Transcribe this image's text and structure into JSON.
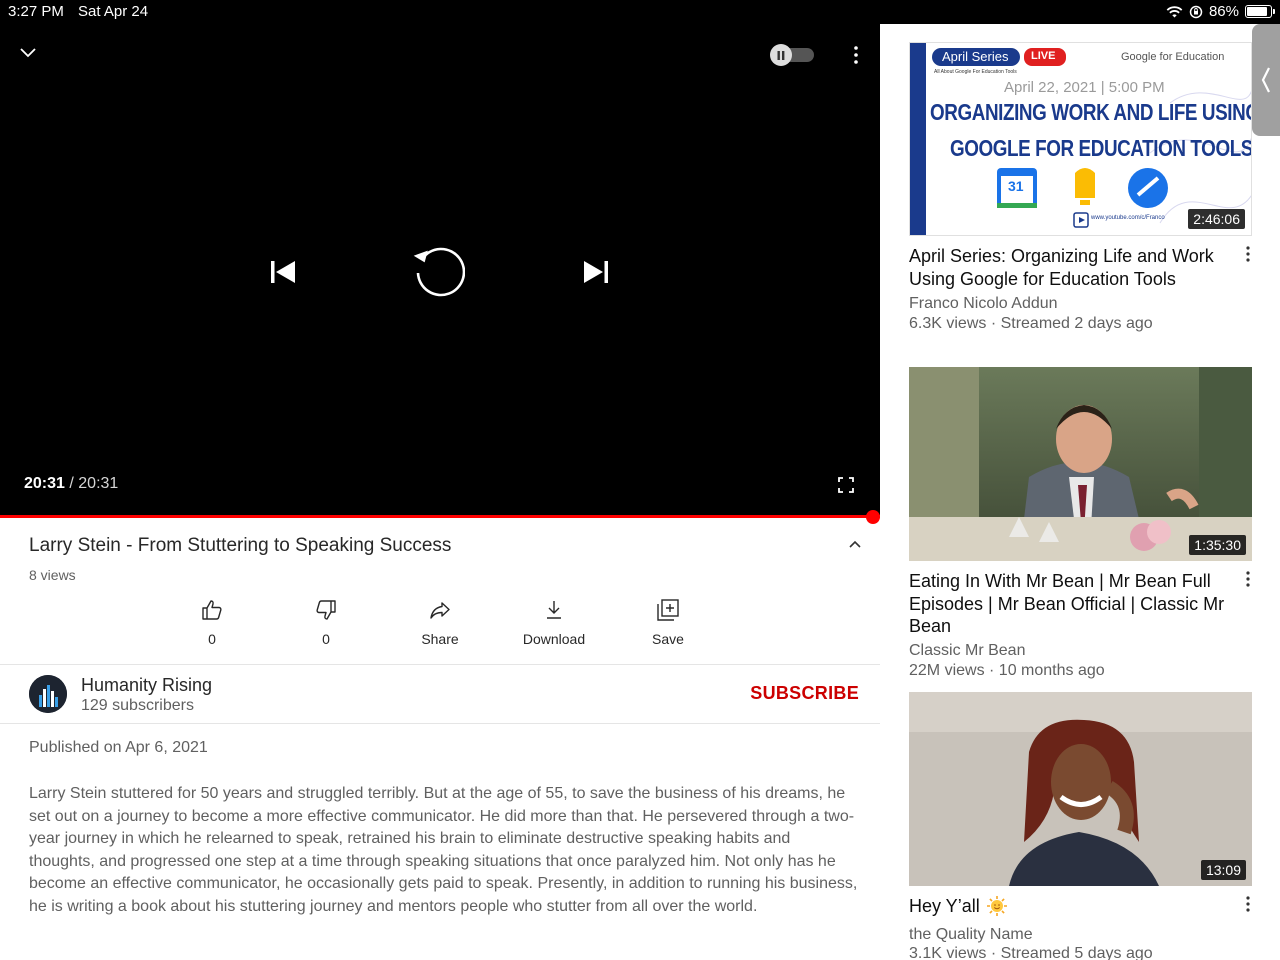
{
  "status_bar": {
    "time": "3:27 PM",
    "date": "Sat Apr 24",
    "battery": "86%",
    "battery_level": 0.86
  },
  "player": {
    "current_time": "20:31",
    "total_time": "/ 20:31",
    "progress": 1.0,
    "icons": [
      "chevron-down-icon",
      "pause-icon",
      "more-vert-icon",
      "skip-previous-icon",
      "replay-icon",
      "skip-next-icon",
      "fullscreen-icon"
    ]
  },
  "video": {
    "title": "Larry Stein - From Stuttering to Speaking Success",
    "views": "8 views",
    "actions": [
      {
        "label": "0",
        "icon": "thumb-up-icon"
      },
      {
        "label": "0",
        "icon": "thumb-down-icon"
      },
      {
        "label": "Share",
        "icon": "share-icon"
      },
      {
        "label": "Download",
        "icon": "download-icon"
      },
      {
        "label": "Save",
        "icon": "save-playlist-icon"
      }
    ]
  },
  "channel": {
    "name": "Humanity Rising",
    "subscribers": "129 subscribers",
    "subscribe_label": "SUBSCRIBE"
  },
  "description": {
    "published": "Published on Apr 6, 2021",
    "text": "Larry Stein stuttered for 50 years and struggled terribly. But at the age of 55, to save the business of his dreams, he set out on a journey to become a more effective communicator. He did more than that. He persevered through a two-year journey in which he relearned to speak, retrained his brain to eliminate destructive speaking habits and thoughts, and progressed one step at a time through speaking situations that once paralyzed him. Not only has he become an effective communicator, he occasionally gets paid to speak. Presently, in addition to running his business, he is writing a book about his stuttering journey and mentors people who stutter from all over the world."
  },
  "recommendations": [
    {
      "title": "April Series: Organizing Life and Work Using Google for Education Tools",
      "channel": "Franco Nicolo Addun",
      "meta": "6.3K views · Streamed 2 days ago",
      "duration": "2:46:06",
      "thumb": {
        "badge": "April Series",
        "live": "LIVE",
        "brand": "Google for Education",
        "sub": "All About Google For Education Tools",
        "date": "April 22, 2021 | 5:00 PM",
        "line1": "ORGANIZING WORK AND LIFE USING",
        "line2": "GOOGLE FOR EDUCATION TOOLS",
        "calendar_day": "31",
        "url": "www.youtube.com/c/Franco"
      }
    },
    {
      "title": "Eating In With Mr Bean | Mr Bean Full Episodes | Mr Bean Official | Classic Mr Bean",
      "channel": "Classic Mr Bean",
      "meta": "22M views · 10 months ago",
      "duration": "1:35:30"
    },
    {
      "title": "Hey Y’all",
      "channel": "the Quality Name",
      "meta": "3.1K views · Streamed 5 days ago",
      "duration": "13:09"
    }
  ],
  "colors": {
    "accent": "#ff0000",
    "subscribe": "#cc0000",
    "text_secondary": "#606060"
  }
}
